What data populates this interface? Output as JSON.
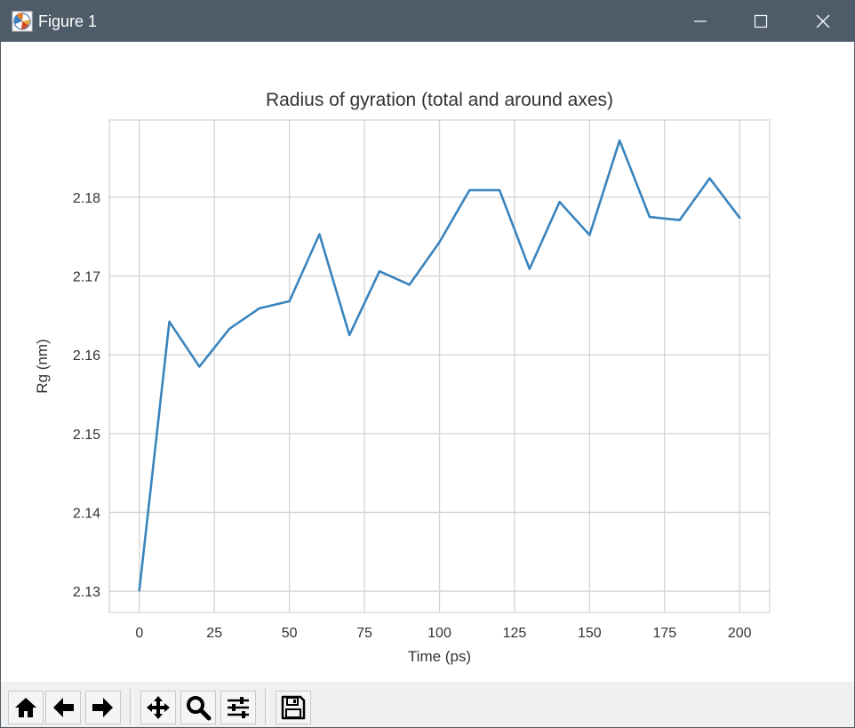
{
  "window": {
    "title": "Figure 1",
    "titlebar_color": "#4e5b69",
    "icons": [
      "app-figure-icon",
      "minimize-icon",
      "maximize-icon",
      "close-icon"
    ]
  },
  "toolbar": {
    "buttons": [
      {
        "name": "home",
        "icon": "home-icon"
      },
      {
        "name": "back",
        "icon": "arrow-left-icon"
      },
      {
        "name": "forward",
        "icon": "arrow-right-icon"
      },
      {
        "name": "pan",
        "icon": "move-icon"
      },
      {
        "name": "zoom",
        "icon": "magnifier-icon"
      },
      {
        "name": "configure-subplots",
        "icon": "sliders-icon"
      },
      {
        "name": "save",
        "icon": "floppy-disk-icon"
      }
    ]
  },
  "chart_data": {
    "type": "line",
    "title": "Radius of gyration (total and around axes)",
    "xlabel": "Time (ps)",
    "ylabel": "Rg (nm)",
    "x": [
      0,
      10,
      20,
      30,
      40,
      50,
      60,
      70,
      80,
      90,
      100,
      110,
      120,
      130,
      140,
      150,
      160,
      170,
      180,
      190,
      200
    ],
    "series": [
      {
        "values": [
          2.1301,
          2.1642,
          2.1585,
          2.1633,
          2.1659,
          2.1668,
          2.1753,
          2.1625,
          2.1706,
          2.1689,
          2.1743,
          2.1809,
          2.1809,
          2.1709,
          2.1794,
          2.1752,
          2.1872,
          2.1775,
          2.1771,
          2.1824,
          2.1774
        ],
        "color": "#3a84bd"
      }
    ],
    "xticks": [
      0,
      25,
      50,
      75,
      100,
      125,
      150,
      175,
      200
    ],
    "xtick_labels": [
      "0",
      "25",
      "50",
      "75",
      "100",
      "125",
      "150",
      "175",
      "200"
    ],
    "yticks": [
      2.13,
      2.14,
      2.15,
      2.16,
      2.17,
      2.18
    ],
    "ytick_labels": [
      "2.13",
      "2.14",
      "2.15",
      "2.16",
      "2.17",
      "2.18"
    ],
    "xlim": [
      -10,
      210
    ],
    "ylim": [
      2.1273,
      2.1898
    ],
    "grid": true,
    "grid_color": "#d4d4d4",
    "text_color": "#333333"
  }
}
